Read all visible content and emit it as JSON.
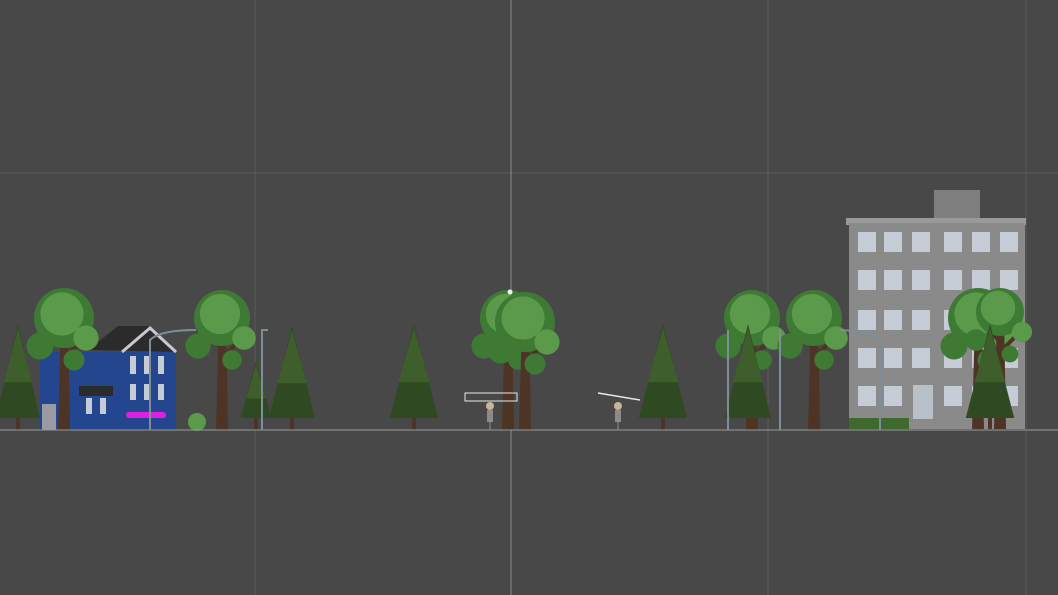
{
  "scene": {
    "view": "scene-view-2d",
    "colors": {
      "background": "#484848",
      "grid_line": "#5a5a5a",
      "axis_line": "#8c8c8c",
      "ground_line": "#9a9a9a",
      "pine_dark": "#2f4a22",
      "pine_mid": "#3e5f2b",
      "leaf_dark": "#3e7a34",
      "leaf_light": "#5a9a4a",
      "trunk": "#4e3424",
      "house_blue": "#23468f",
      "house_roof": "#2b2b2b",
      "house_trim": "#c8c8d4",
      "building_gray": "#8a8a8a",
      "building_window": "#c5ccd6",
      "selection_outline": "#e8e8e8",
      "magenta_marker": "#e020e0",
      "lamp_post": "#7e8e96"
    },
    "icons": [
      "pine-tree-icon",
      "leafy-tree-icon",
      "house-icon",
      "apartment-building-icon",
      "character-icon",
      "street-lamp-icon"
    ]
  }
}
